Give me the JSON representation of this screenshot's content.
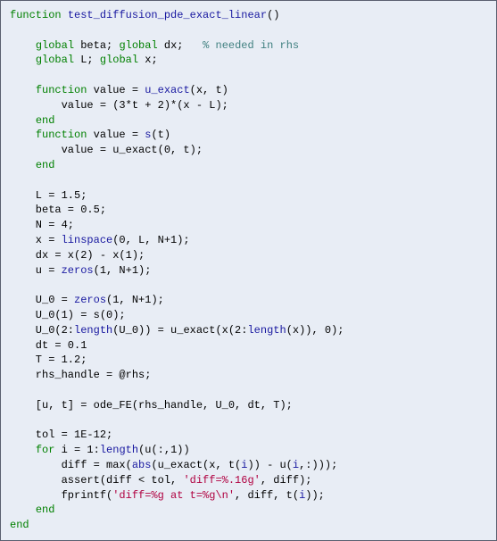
{
  "code": {
    "l01a": "function",
    "l01b": "test_diffusion_pde_exact_linear",
    "l01c": "()",
    "l02": "",
    "l03a": "    ",
    "l03b": "global",
    "l03c": " beta; ",
    "l03d": "global",
    "l03e": " dx;   ",
    "l03f": "% needed in rhs",
    "l04a": "    ",
    "l04b": "global",
    "l04c": " L; ",
    "l04d": "global",
    "l04e": " x;",
    "l05": "",
    "l06a": "    ",
    "l06b": "function",
    "l06c": " value = ",
    "l06d": "u_exact",
    "l06e": "(x, t)",
    "l07": "        value = (3*t + 2)*(x - L);",
    "l08a": "    ",
    "l08b": "end",
    "l09a": "    ",
    "l09b": "function",
    "l09c": " value = ",
    "l09d": "s",
    "l09e": "(t)",
    "l10": "        value = u_exact(0, t);",
    "l11a": "    ",
    "l11b": "end",
    "l12": "",
    "l13": "    L = 1.5;",
    "l14": "    beta = 0.5;",
    "l15": "    N = 4;",
    "l16a": "    x = ",
    "l16b": "linspace",
    "l16c": "(0, L, N+1);",
    "l17": "    dx = x(2) - x(1);",
    "l18a": "    u = ",
    "l18b": "zeros",
    "l18c": "(1, N+1);",
    "l19": "",
    "l20a": "    U_0 = ",
    "l20b": "zeros",
    "l20c": "(1, N+1);",
    "l21": "    U_0(1) = s(0);",
    "l22a": "    U_0(2:",
    "l22b": "length",
    "l22c": "(U_0)) = u_exact(x(2:",
    "l22d": "length",
    "l22e": "(x)), 0);",
    "l23": "    dt = 0.1",
    "l24": "    T = 1.2;",
    "l25": "    rhs_handle = @rhs;",
    "l26": "",
    "l27": "    [u, t] = ode_FE(rhs_handle, U_0, dt, T);",
    "l28": "",
    "l29": "    tol = 1E-12;",
    "l30a": "    ",
    "l30b": "for",
    "l30c": " i = 1:",
    "l30d": "length",
    "l30e": "(u(:,1))",
    "l31a": "        diff = max(",
    "l31b": "abs",
    "l31c": "(u_exact(x, t(",
    "l31d": "i",
    "l31e": ")) - u(",
    "l31f": "i",
    "l31g": ",:)));",
    "l32a": "        assert(diff < tol, ",
    "l32b": "'diff=%.16g'",
    "l32c": ", diff);",
    "l33a": "        fprintf(",
    "l33b": "'diff=%g at t=%g\\n'",
    "l33c": ", diff, t(",
    "l33d": "i",
    "l33e": "));",
    "l34a": "    ",
    "l34b": "end",
    "l35": "end"
  }
}
